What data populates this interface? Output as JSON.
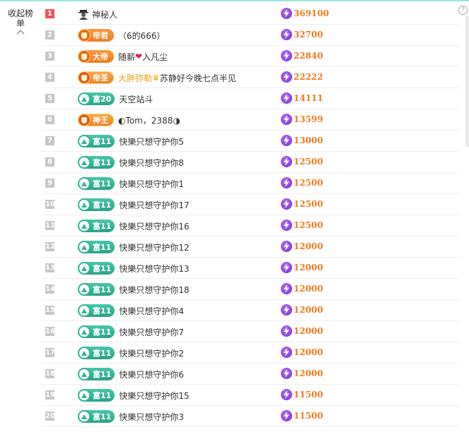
{
  "panel": {
    "collapse_label": "收起榜单",
    "help_glyph": "?"
  },
  "rows": [
    {
      "rank": "1",
      "badge": "",
      "name": "神秘人",
      "value": "369100",
      "first": true,
      "icon": "mystery-user-icon"
    },
    {
      "rank": "2",
      "badge": "帝君",
      "name": "（6的666）",
      "value": "32700"
    },
    {
      "rank": "3",
      "badge": "大帝",
      "name": "随薪",
      "name2": "入凡尘",
      "value": "22840"
    },
    {
      "rank": "4",
      "badge": "帝圣",
      "name": "大胖弥勒",
      "name2": "苏静好今晚七点半见",
      "value": "22222"
    },
    {
      "rank": "5",
      "badge": "富20",
      "name": "天空站斗",
      "value": "14111"
    },
    {
      "rank": "6",
      "badge": "神王",
      "name": "◐Tom，2388◑",
      "value": "13599"
    },
    {
      "rank": "7",
      "badge": "富11",
      "name": "快樂只想守护你5",
      "value": "13000"
    },
    {
      "rank": "8",
      "badge": "富11",
      "name": "快樂只想守护你8",
      "value": "12500"
    },
    {
      "rank": "9",
      "badge": "富11",
      "name": "快樂只想守护你1",
      "value": "12500"
    },
    {
      "rank": "10",
      "badge": "富11",
      "name": "快樂只想守护你17",
      "value": "12500"
    },
    {
      "rank": "11",
      "badge": "富11",
      "name": "快樂只想守护你16",
      "value": "12500"
    },
    {
      "rank": "12",
      "badge": "富11",
      "name": "快樂只想守护你12",
      "value": "12000"
    },
    {
      "rank": "13",
      "badge": "富11",
      "name": "快樂只想守护你13",
      "value": "12000"
    },
    {
      "rank": "14",
      "badge": "富11",
      "name": "快樂只想守护你18",
      "value": "12000"
    },
    {
      "rank": "15",
      "badge": "富11",
      "name": "快樂只想守护你4",
      "value": "12000"
    },
    {
      "rank": "16",
      "badge": "富11",
      "name": "快樂只想守护你7",
      "value": "12000"
    },
    {
      "rank": "17",
      "badge": "富11",
      "name": "快樂只想守护你2",
      "value": "12000"
    },
    {
      "rank": "18",
      "badge": "富11",
      "name": "快樂只想守护你6",
      "value": "12000"
    },
    {
      "rank": "19",
      "badge": "富11",
      "name": "快樂只想守护你15",
      "value": "11500"
    },
    {
      "rank": "20",
      "badge": "富11",
      "name": "快樂只想守护你3",
      "value": "11500"
    }
  ],
  "colors": {
    "rank_first": "#f2545b",
    "rank_default": "#c6c6c6",
    "value": "#f07a1e",
    "teal_badge": "#2aa389",
    "orange_badge": "#f07b1d"
  }
}
